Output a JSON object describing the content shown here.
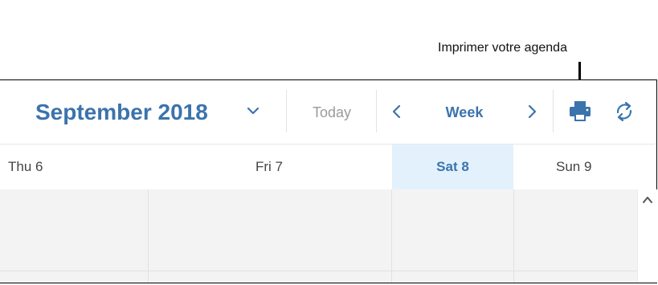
{
  "annotation": {
    "label": "Imprimer votre agenda"
  },
  "header": {
    "month_title": "September 2018",
    "today_label": "Today",
    "view_label": "Week"
  },
  "days": [
    {
      "label": "Thu 6",
      "selected": false
    },
    {
      "label": "Fri 7",
      "selected": false
    },
    {
      "label": "Sat 8",
      "selected": true
    },
    {
      "label": "Sun 9",
      "selected": false
    }
  ],
  "icons": {
    "month_dropdown": "chevron-down-icon",
    "prev": "chevron-left-icon",
    "next": "chevron-right-icon",
    "print": "printer-icon",
    "refresh": "refresh-icon",
    "scroll_up": "chevron-up-icon"
  },
  "colors": {
    "accent": "#3b73ad",
    "selected_day_bg": "#e3f1fc",
    "muted_text": "#9b9b9b",
    "grid_bg": "#f3f3f3"
  }
}
